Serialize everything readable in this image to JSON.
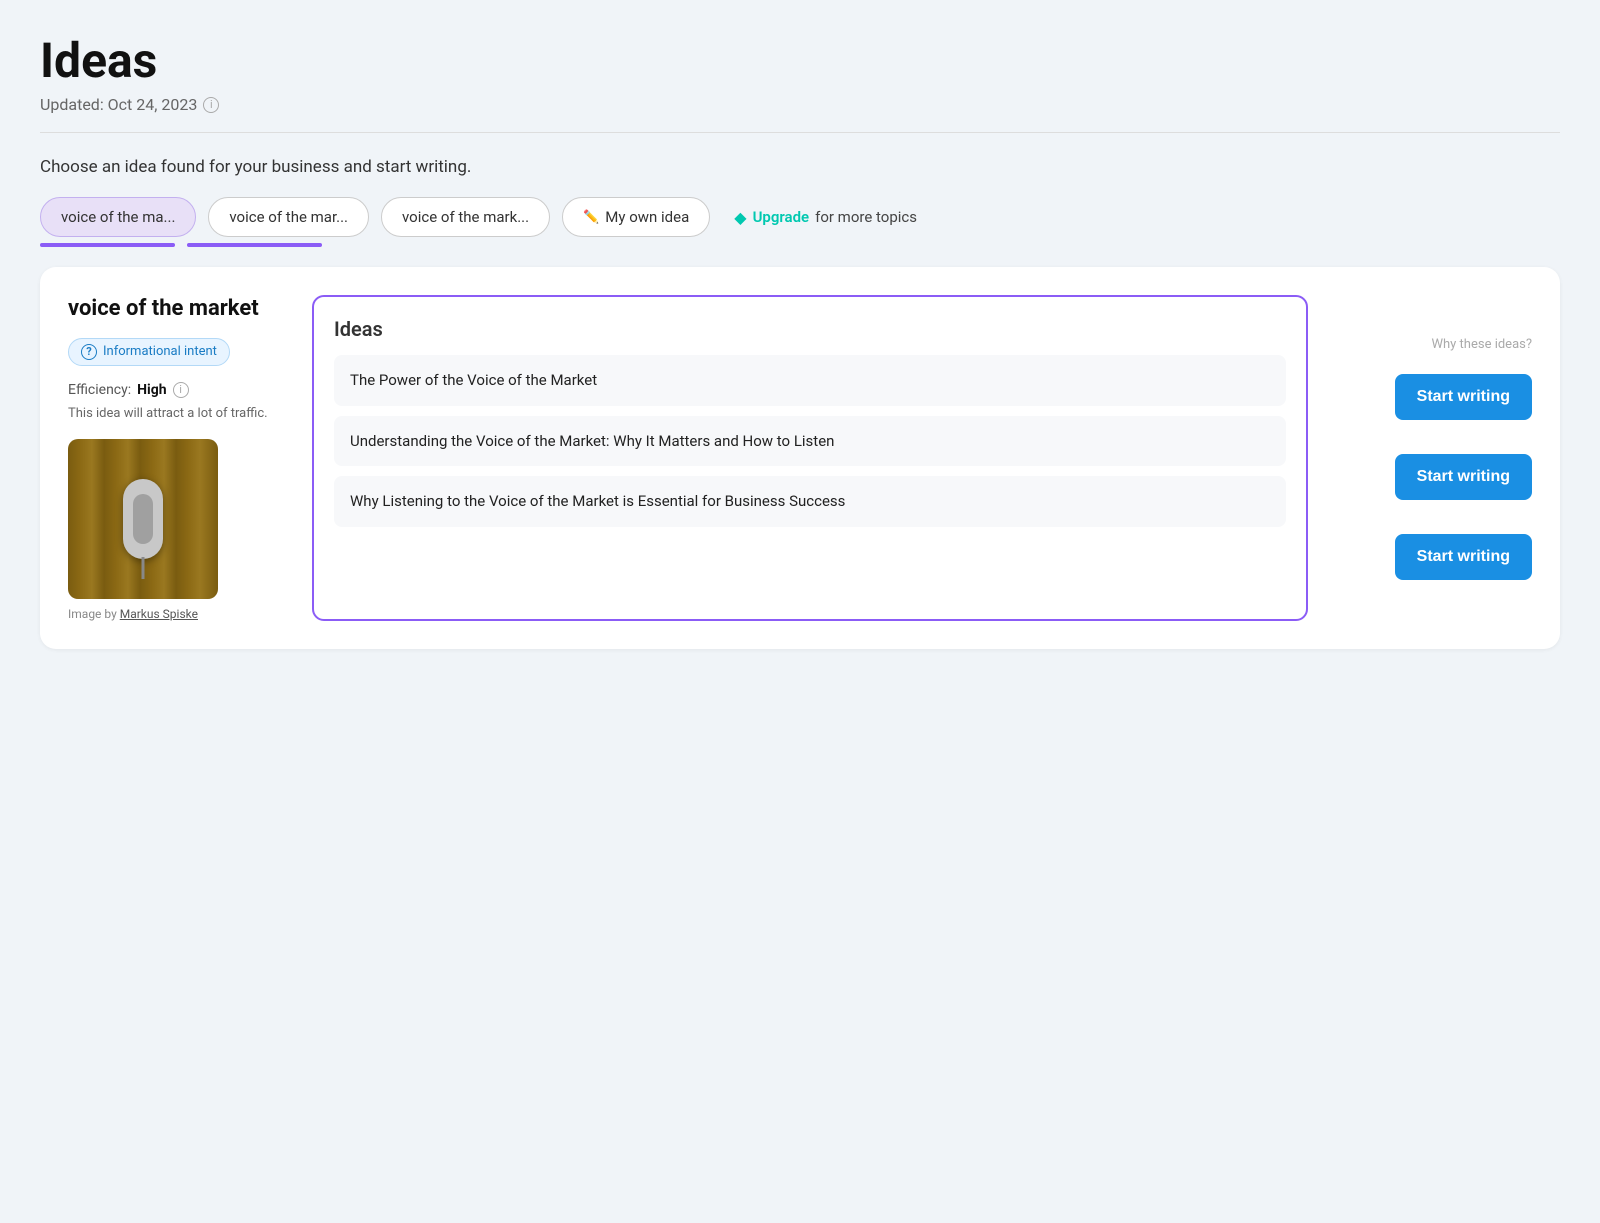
{
  "page": {
    "title": "Ideas",
    "updated": "Updated: Oct 24, 2023",
    "choose_text": "Choose an idea found for your business and start writing."
  },
  "topics": {
    "items": [
      {
        "id": "topic-1",
        "label": "voice of the ma...",
        "active": true
      },
      {
        "id": "topic-2",
        "label": "voice of the mar...",
        "active": false
      },
      {
        "id": "topic-3",
        "label": "voice of the mark...",
        "active": false
      }
    ],
    "own_idea": "My own idea",
    "upgrade_label": "Upgrade",
    "upgrade_suffix": "for more topics"
  },
  "keyword": {
    "title": "voice of the market",
    "intent_label": "Informational intent",
    "efficiency_label": "Efficiency:",
    "efficiency_value": "High",
    "efficiency_desc": "This idea will attract a lot of traffic.",
    "image_caption": "Image by",
    "image_author": "Markus Spiske"
  },
  "ideas_panel": {
    "title": "Ideas",
    "why_label": "Why these ideas?",
    "items": [
      {
        "id": "idea-1",
        "text": "The Power of the Voice of the Market"
      },
      {
        "id": "idea-2",
        "text": "Understanding the Voice of the Market: Why It Matters and How to Listen"
      },
      {
        "id": "idea-3",
        "text": "Why Listening to the Voice of the Market is Essential for Business Success"
      }
    ],
    "start_writing_label": "Start writing"
  }
}
